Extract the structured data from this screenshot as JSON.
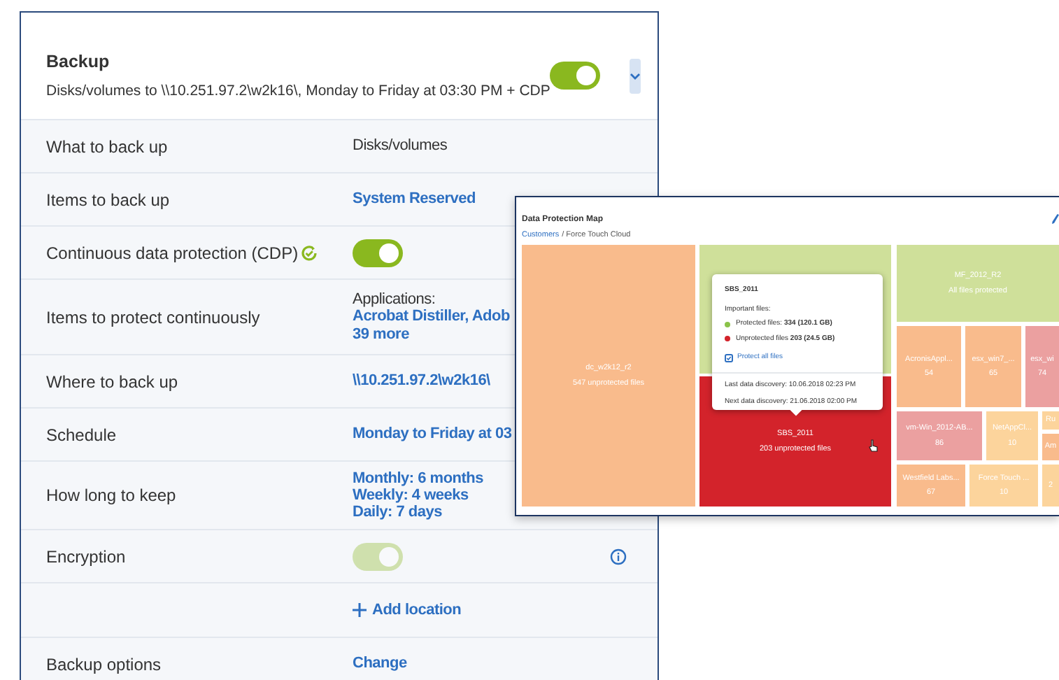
{
  "plan": {
    "title": "Backup",
    "subtitle": "Disks/volumes to \\\\10.251.97.2\\w2k16\\, Monday to Friday at 03:30 PM + CDP",
    "on": true,
    "expanded": false
  },
  "rows": [
    {
      "label": "What to back up",
      "kind": "text",
      "value": "Disks/volumes"
    },
    {
      "label": "Items to back up",
      "kind": "link",
      "value": "System Reserved"
    },
    {
      "label": "Continuous data protection (CDP)",
      "kind": "toggle",
      "status_icon": true,
      "on": true,
      "disabled": false
    },
    {
      "label": "Items to protect continuously",
      "kind": "apps",
      "caption": "Applications:",
      "links": [
        "Acrobat Distiller, Adob",
        "39 more"
      ]
    },
    {
      "label": "Where to back up",
      "kind": "link",
      "value": "\\\\10.251.97.2\\w2k16\\"
    },
    {
      "label": "Schedule",
      "kind": "link",
      "value": "Monday to Friday at 03"
    },
    {
      "label": "How long to keep",
      "kind": "lines",
      "lines": [
        "Monthly: 6 months",
        "Weekly: 4 weeks",
        "Daily: 7 days"
      ]
    },
    {
      "label": "Encryption",
      "kind": "toggle",
      "on": true,
      "disabled": true,
      "info": true
    },
    {
      "kind": "add",
      "value": "Add location"
    },
    {
      "label": "Backup options",
      "kind": "link",
      "value": "Change"
    }
  ],
  "map": {
    "title": "Data Protection Map",
    "breadcrumb": [
      "Customers",
      "/ Force Touch Cloud"
    ],
    "tiles": [
      {
        "name": "dc_w2k12_r2",
        "value": "547 unprotected files",
        "color": "#f9bb8c"
      },
      {
        "color": "#cfe09a"
      },
      {
        "name": "SBS_2011",
        "value": "203 unprotected files",
        "color": "#d3232b"
      },
      {
        "name": "MF_2012_R2",
        "value": "All files protected",
        "color": "#cfe09a"
      },
      {
        "name": "AcronisAppl...",
        "value": "54",
        "color": "#f9bb8c"
      },
      {
        "name": "esx_win7_...",
        "value": "65",
        "color": "#f9bb8c"
      },
      {
        "name": "esx_wi",
        "value": "74",
        "color": "#eba0a0"
      },
      {
        "name": "vm-Win_2012-AB...",
        "value": "86",
        "color": "#eba0a0"
      },
      {
        "name": "NetAppCl...",
        "value": "10",
        "color": "#fcd49c"
      },
      {
        "name": "Ru",
        "color": "#fcd49c"
      },
      {
        "name": "Am",
        "color": "#f9bb8c"
      },
      {
        "name": "Westfield Labs...",
        "value": "67",
        "color": "#f9bb8c"
      },
      {
        "name": "Force Touch ...",
        "value": "10",
        "color": "#fcd49c"
      },
      {
        "name": "2",
        "color": "#fcd49c"
      }
    ],
    "tooltip": {
      "title": "SBS_2011",
      "caption": "Important files:",
      "items": [
        {
          "text": "Protected files: **334 (120.1 GB)**",
          "color": "#8bc34a"
        },
        {
          "text": "Unprotected files **203 (24.5 GB)**",
          "color": "#d3232b"
        }
      ],
      "action": "Protect all files",
      "footer": [
        "Last data discovery: 10.06.2018 02:23 PM",
        "Next data discovery: 21.06.2018 02:00 PM"
      ]
    }
  }
}
